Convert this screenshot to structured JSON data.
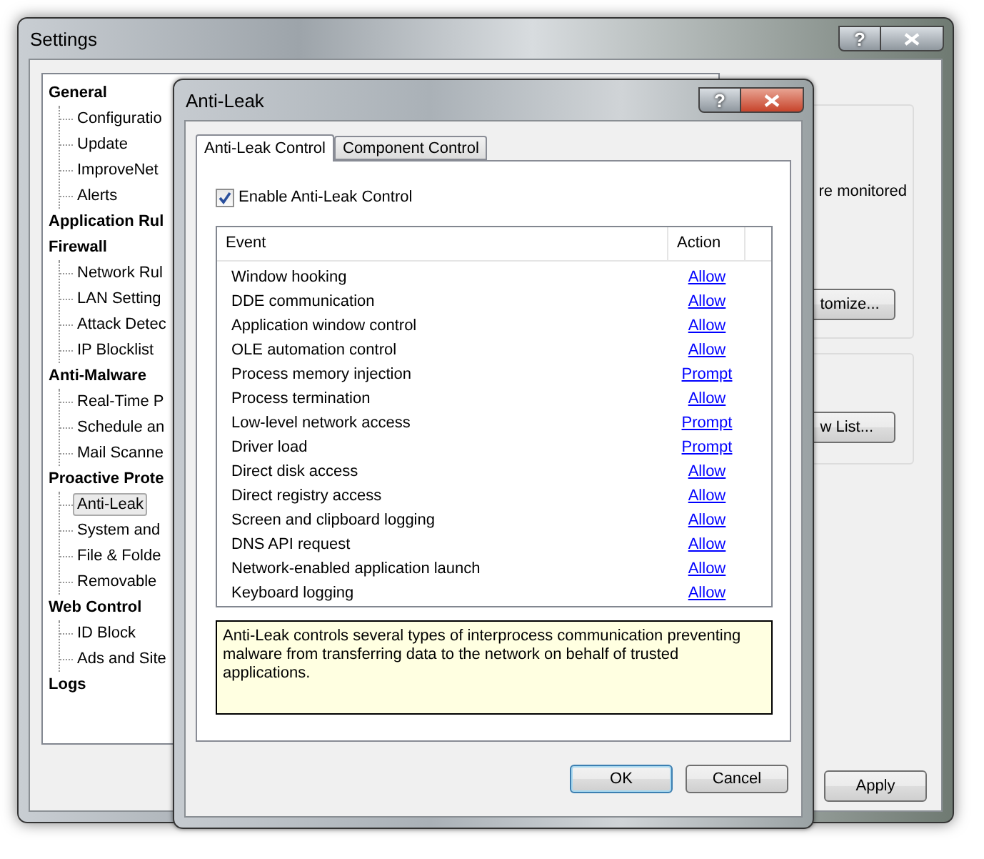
{
  "settings_window": {
    "title": "Settings",
    "help_glyph": "?",
    "tree": [
      {
        "label": "General",
        "children": [
          {
            "label": "Configuratio",
            "selected": false
          },
          {
            "label": "Update",
            "selected": false
          },
          {
            "label": "ImproveNet",
            "selected": false
          },
          {
            "label": "Alerts",
            "selected": false
          }
        ]
      },
      {
        "label": "Application Rul"
      },
      {
        "label": "Firewall",
        "children": [
          {
            "label": "Network Rul",
            "selected": false
          },
          {
            "label": "LAN Setting",
            "selected": false
          },
          {
            "label": "Attack Detec",
            "selected": false
          },
          {
            "label": "IP Blocklist",
            "selected": false
          }
        ]
      },
      {
        "label": "Anti-Malware",
        "children": [
          {
            "label": "Real-Time P",
            "selected": false
          },
          {
            "label": "Schedule an",
            "selected": false
          },
          {
            "label": "Mail Scanne",
            "selected": false
          }
        ]
      },
      {
        "label": "Proactive Prote",
        "children": [
          {
            "label": "Anti-Leak",
            "selected": true
          },
          {
            "label": "System and",
            "selected": false
          },
          {
            "label": "File & Folde",
            "selected": false
          },
          {
            "label": "Removable",
            "selected": false
          }
        ]
      },
      {
        "label": "Web Control",
        "children": [
          {
            "label": "ID Block",
            "selected": false
          },
          {
            "label": "Ads and Site",
            "selected": false
          }
        ]
      },
      {
        "label": "Logs"
      }
    ],
    "groups": [
      {
        "text": "re monitored",
        "button": "tomize..."
      },
      {
        "button": "w List..."
      }
    ],
    "apply_button": "Apply"
  },
  "dialog": {
    "title": "Anti-Leak",
    "help_glyph": "?",
    "tabs": [
      {
        "label": "Anti-Leak Control",
        "selected": true
      },
      {
        "label": "Component Control",
        "selected": false
      }
    ],
    "enable_checkbox": {
      "label": "Enable Anti-Leak Control",
      "checked": true
    },
    "columns": [
      "Event",
      "Action"
    ],
    "rows": [
      {
        "event": "Window hooking",
        "action": "Allow"
      },
      {
        "event": "DDE communication",
        "action": "Allow"
      },
      {
        "event": "Application window control",
        "action": "Allow"
      },
      {
        "event": "OLE automation control",
        "action": "Allow"
      },
      {
        "event": "Process memory injection",
        "action": "Prompt"
      },
      {
        "event": "Process termination",
        "action": "Allow"
      },
      {
        "event": "Low-level network access",
        "action": "Prompt"
      },
      {
        "event": "Driver load",
        "action": "Prompt"
      },
      {
        "event": "Direct disk access",
        "action": "Allow"
      },
      {
        "event": "Direct registry access",
        "action": "Allow"
      },
      {
        "event": "Screen and clipboard logging",
        "action": "Allow"
      },
      {
        "event": "DNS API request",
        "action": "Allow"
      },
      {
        "event": "Network-enabled application launch",
        "action": "Allow"
      },
      {
        "event": "Keyboard logging",
        "action": "Allow"
      }
    ],
    "description": "Anti-Leak controls several types of interprocess communication preventing malware from transferring data to the network on behalf of trusted applications.",
    "buttons": [
      {
        "label": "OK",
        "default": true
      },
      {
        "label": "Cancel",
        "default": false
      }
    ]
  }
}
